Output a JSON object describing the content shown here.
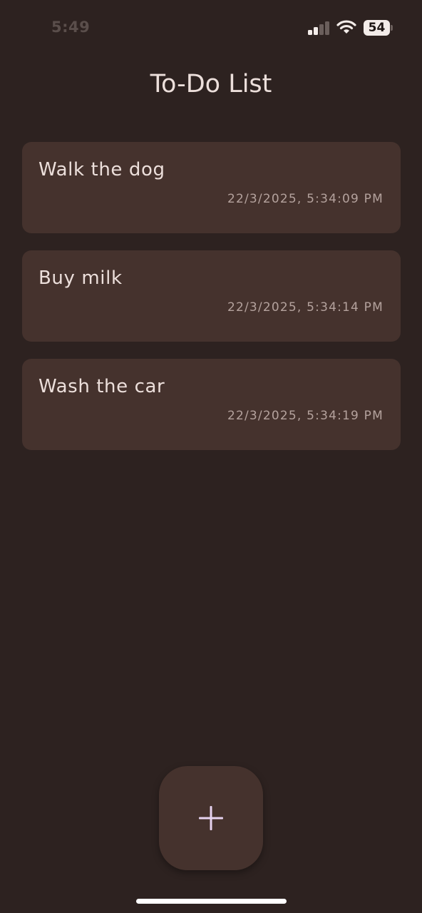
{
  "status_bar": {
    "time": "5:49",
    "battery_level": "54",
    "signal_icon": "cellular-signal-icon",
    "wifi_icon": "wifi-icon",
    "battery_icon": "battery-icon"
  },
  "header": {
    "title": "To-Do List"
  },
  "todos": [
    {
      "title": "Walk the dog",
      "timestamp": "22/3/2025, 5:34:09 PM"
    },
    {
      "title": "Buy milk",
      "timestamp": "22/3/2025, 5:34:14 PM"
    },
    {
      "title": "Wash the car",
      "timestamp": "22/3/2025, 5:34:19 PM"
    }
  ],
  "fab": {
    "icon": "plus-icon"
  },
  "colors": {
    "background": "#2d2220",
    "card": "#45322d",
    "text": "#ecdfdb",
    "timestamp": "#b4a29d",
    "fab_plus": "#e6d3f0"
  }
}
